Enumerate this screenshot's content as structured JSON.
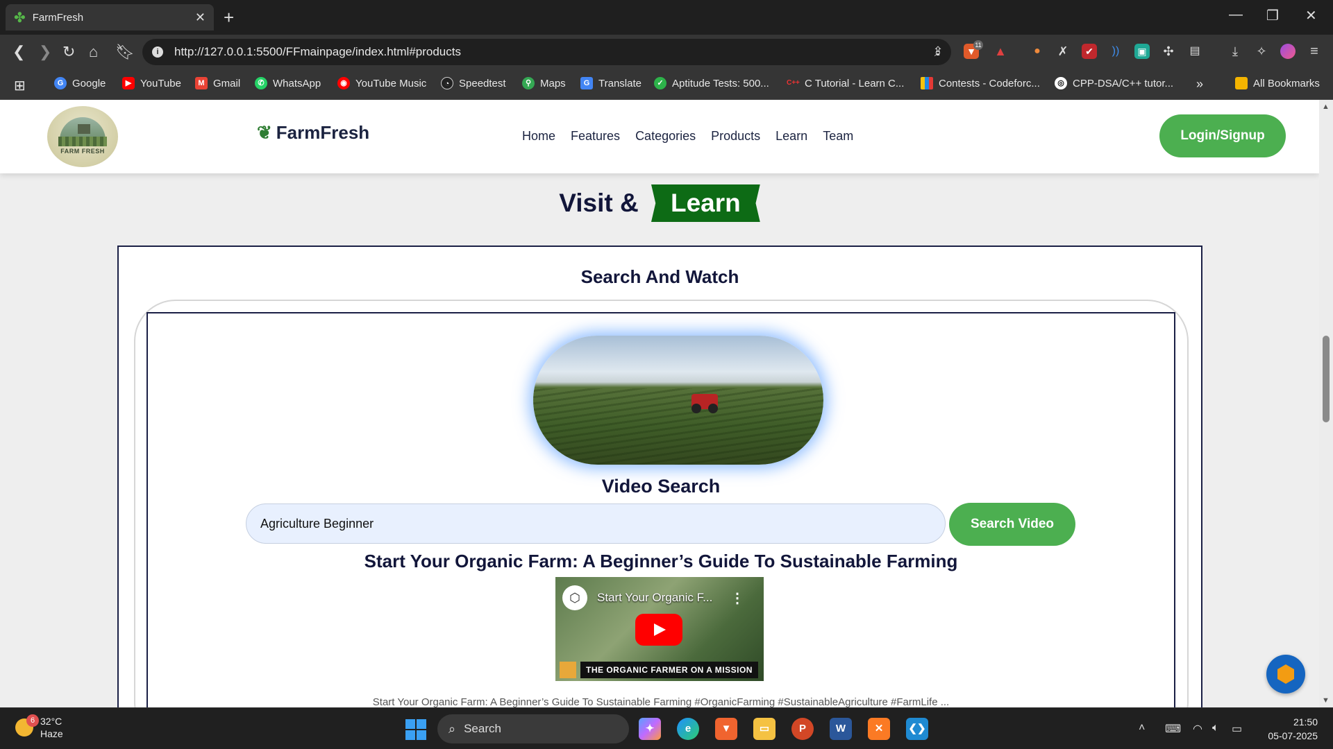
{
  "browser": {
    "tab_title": "FarmFresh",
    "url": "http://127.0.0.1:5500/FFmainpage/index.html#products",
    "bookmarks": [
      "Google",
      "YouTube",
      "Gmail",
      "WhatsApp",
      "YouTube Music",
      "Speedtest",
      "Maps",
      "Translate",
      "Aptitude Tests: 500...",
      "C Tutorial - Learn C...",
      "Contests - Codeforc...",
      "CPP-DSA/C++ tutor..."
    ],
    "all_bookmarks": "All Bookmarks",
    "extension_badge": "11"
  },
  "header": {
    "logo_text": "FARM FRESH",
    "brand": "FarmFresh",
    "nav": [
      "Home",
      "Features",
      "Categories",
      "Products",
      "Learn",
      "Team"
    ],
    "login_label": "Login/Signup"
  },
  "section": {
    "title_pre": "Visit &",
    "title_highlight": "Learn"
  },
  "panel": {
    "title": "Search And Watch",
    "video_search_title": "Video Search",
    "search_value": "Agriculture Beginner",
    "search_button": "Search Video",
    "result_title": "Start Your Organic Farm: A Beginner’s Guide To Sustainable Farming",
    "thumb_title": "Start Your Organic F...",
    "thumb_banner": "THE ORGANIC FARMER ON A MISSION",
    "description": "Start Your Organic Farm: A Beginner’s Guide To Sustainable Farming #OrganicFarming #SustainableAgriculture #FarmLife ..."
  },
  "taskbar": {
    "temperature": "32°C",
    "weather": "Haze",
    "weather_badge": "6",
    "search_label": "Search",
    "time": "21:50",
    "date": "05-07-2025"
  },
  "colors": {
    "accent_green": "#4caf50",
    "dark_green": "#0d6b15",
    "navy": "#12163a"
  }
}
